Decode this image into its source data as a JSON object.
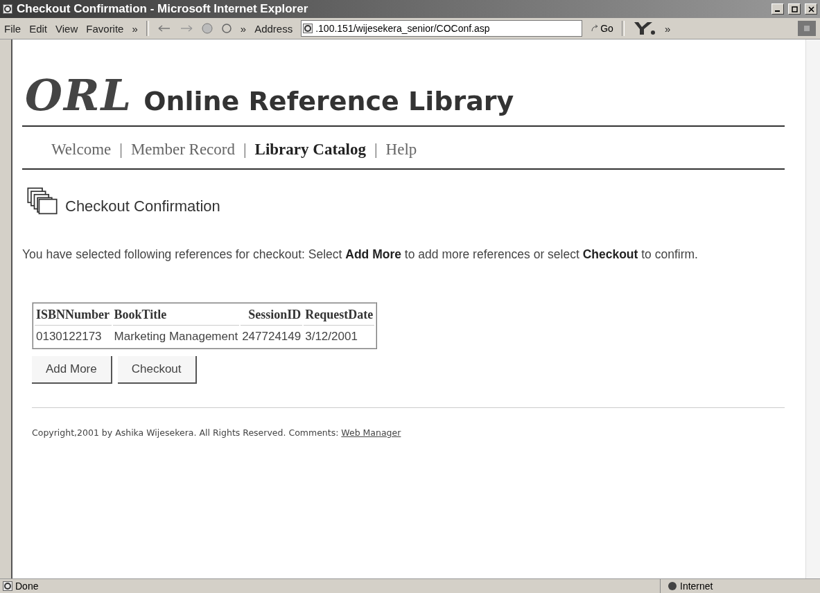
{
  "window": {
    "title": "Checkout Confirmation - Microsoft Internet Explorer"
  },
  "menu": [
    "File",
    "Edit",
    "View",
    "Favorite",
    "»"
  ],
  "toolbar": {
    "more": "»",
    "address_label": "Address",
    "address": ".100.151/wijesekera_senior/COConf.asp",
    "go": "Go",
    "more_right": "»"
  },
  "site": {
    "logo": "ORL",
    "title": "Online Reference Library"
  },
  "nav": [
    {
      "label": "Welcome",
      "selected": false
    },
    {
      "label": "Member Record",
      "selected": false
    },
    {
      "label": "Library Catalog",
      "selected": true
    },
    {
      "label": "Help",
      "selected": false
    }
  ],
  "nav_separator": "|",
  "heading": "Checkout Confirmation",
  "instructions": "You have selected following references for checkout: Select **Add More** to add more references or select **Checkout** to confirm.",
  "table": {
    "columns": [
      "ISBNNumber",
      "BookTitle",
      "SessionID",
      "RequestDate"
    ],
    "rows": [
      [
        "0130122173",
        "Marketing Management",
        "247724149",
        "3/12/2001"
      ]
    ]
  },
  "buttons": [
    "Add More",
    "Checkout"
  ],
  "footer": {
    "text": "Copyright,2001 by Ashika Wijesekera. All Rights Reserved. Comments:",
    "link": "Web Manager"
  },
  "status_bar": {
    "text": "Done",
    "zone": "Internet"
  }
}
